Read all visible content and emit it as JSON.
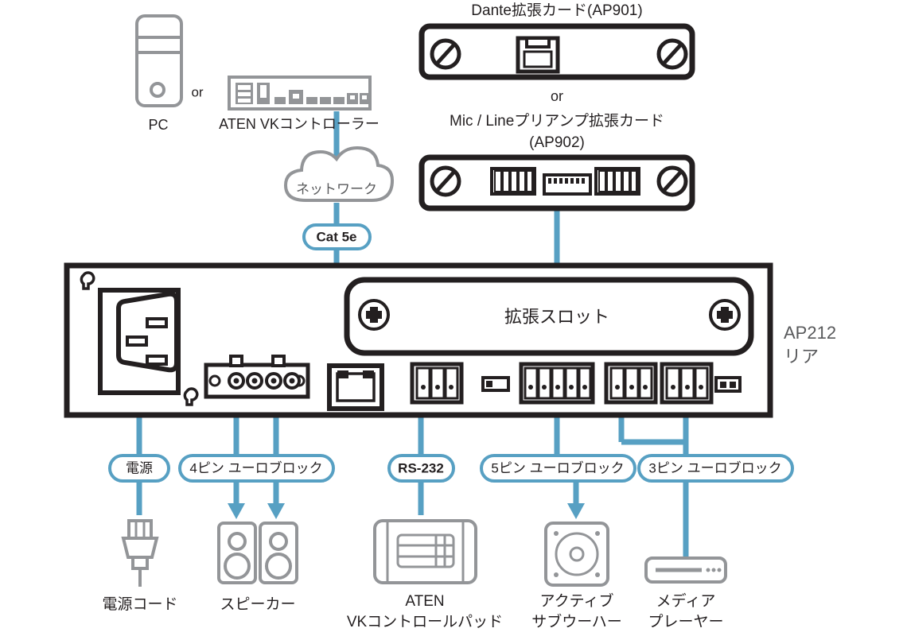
{
  "diagram": {
    "title": "AP212 rear panel connection diagram",
    "colors": {
      "accent_blue": "#57a0c3",
      "dark": "#231f20",
      "grey": "#939598",
      "white": "#ffffff"
    }
  },
  "sources": {
    "pc_label": "PC",
    "or_label": "or",
    "vk_controller_label": "ATEN VKコントローラー",
    "network_cloud_label": "ネットワーク",
    "cat5e_label": "Cat 5e"
  },
  "cards": {
    "dante_label": "Dante拡張カード(AP901)",
    "or_label": "or",
    "preamp_label_line1": "Mic / Lineプリアンプ拡張カード",
    "preamp_label_line2": "(AP902)"
  },
  "device": {
    "name_line1": "AP212",
    "name_line2": "リア",
    "expansion_slot_label": "拡張スロット",
    "ports": [
      {
        "name": "ac-power-inlet",
        "type": "iec-socket"
      },
      {
        "name": "4-pin-euroblock",
        "type": "speaker-terminal",
        "pins": 4
      },
      {
        "name": "ethernet-rj45",
        "type": "rj45"
      },
      {
        "name": "rs232-3pin",
        "type": "euroblock",
        "pins": 3
      },
      {
        "name": "dip-switch-small",
        "type": "switch"
      },
      {
        "name": "5-pin-euroblock",
        "type": "euroblock",
        "pins": 5
      },
      {
        "name": "3-pin-euroblock-a",
        "type": "euroblock",
        "pins": 3
      },
      {
        "name": "3-pin-euroblock-b",
        "type": "euroblock",
        "pins": 3
      },
      {
        "name": "ir-port-small",
        "type": "switch"
      }
    ]
  },
  "cable_labels": [
    {
      "id": "power",
      "text": "電源"
    },
    {
      "id": "pin4",
      "text": "4ピン ユーロブロック"
    },
    {
      "id": "rs232",
      "text": "RS-232"
    },
    {
      "id": "pin5",
      "text": "5ピン ユーロブロック"
    },
    {
      "id": "pin3",
      "text": "3ピン ユーロブロック"
    }
  ],
  "peripherals": [
    {
      "id": "power-cord",
      "label_line1": "電源コード",
      "label_line2": ""
    },
    {
      "id": "speaker",
      "label_line1": "スピーカー",
      "label_line2": ""
    },
    {
      "id": "control-pad",
      "label_line1": "ATEN",
      "label_line2": "VKコントロールパッド"
    },
    {
      "id": "subwoofer",
      "label_line1": "アクティブ",
      "label_line2": "サブウーハー"
    },
    {
      "id": "media-player",
      "label_line1": "メディア",
      "label_line2": "プレーヤー"
    }
  ]
}
